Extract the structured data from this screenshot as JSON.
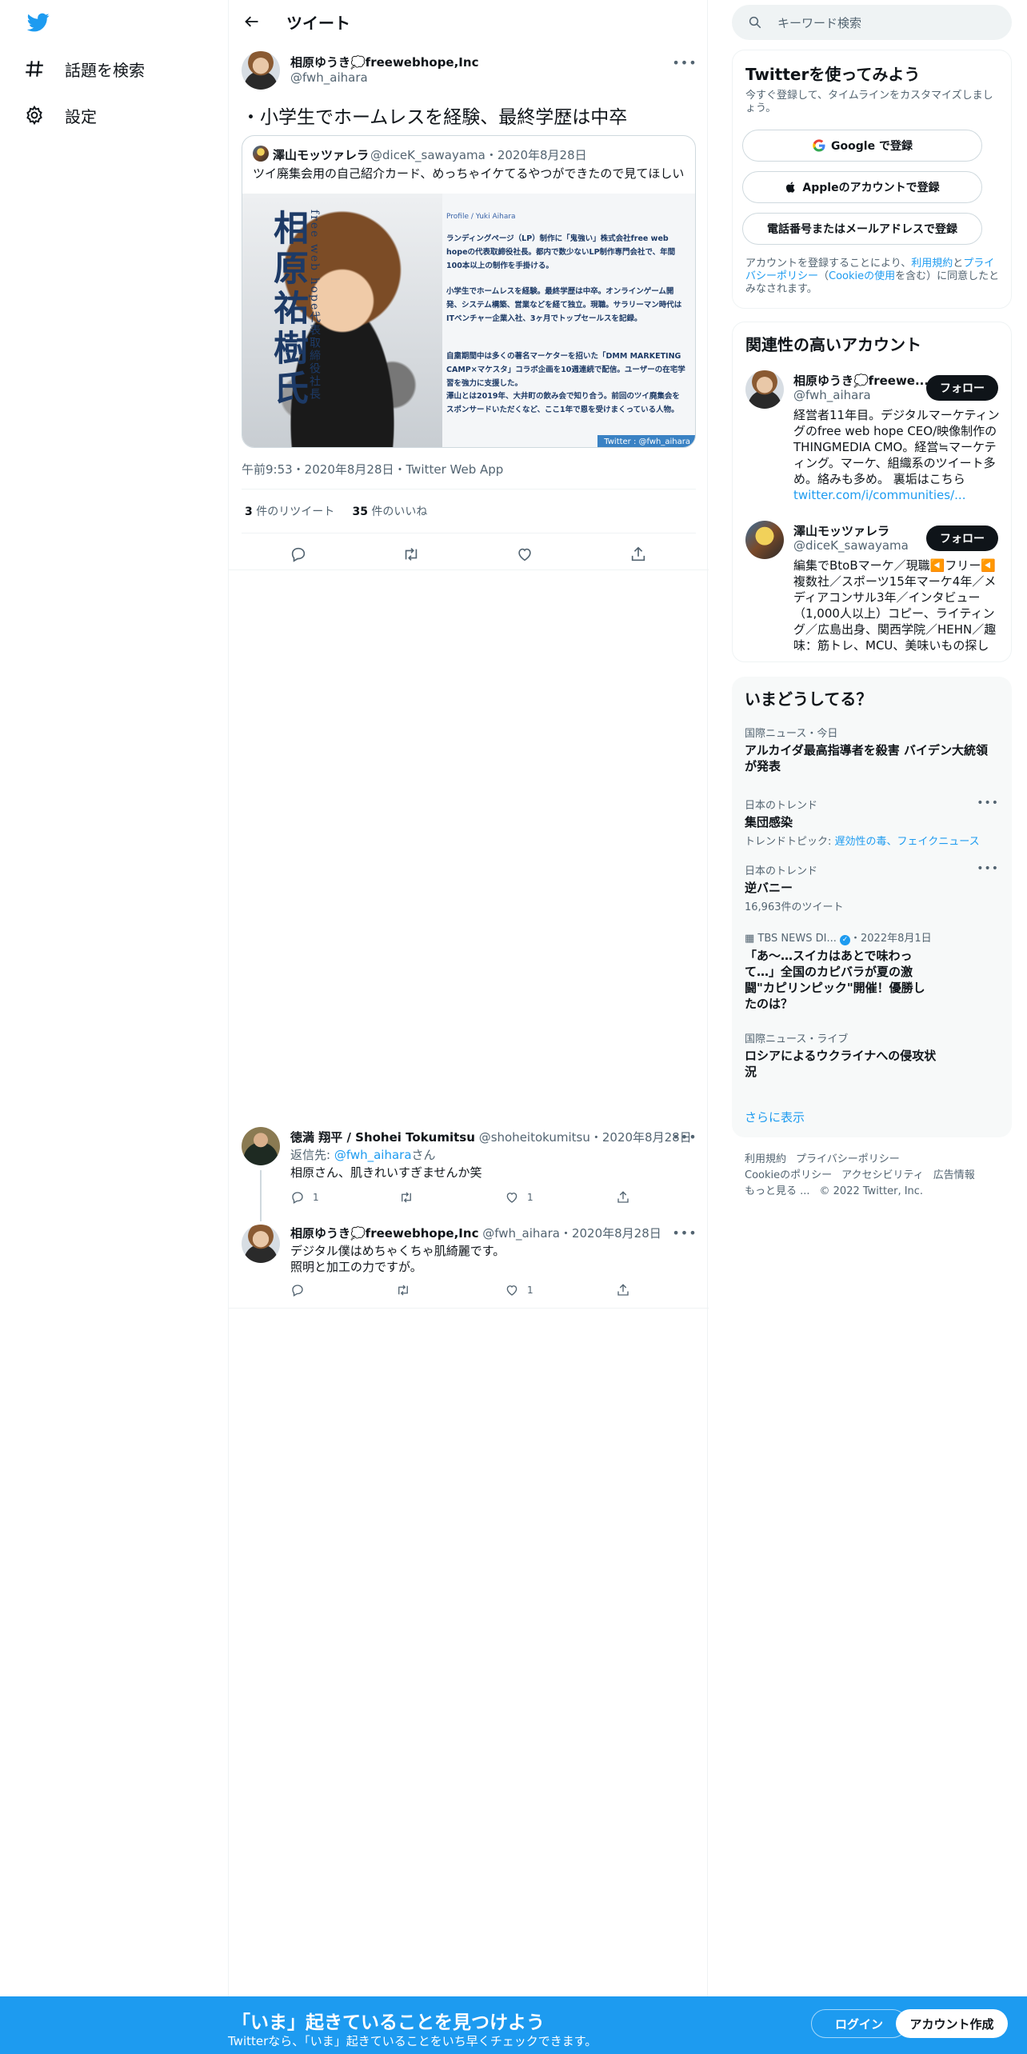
{
  "nav": {
    "items": [
      {
        "label": "話題を検索",
        "icon": "hashtag-icon"
      },
      {
        "label": "設定",
        "icon": "gear-icon"
      }
    ]
  },
  "header": {
    "title": "ツイート"
  },
  "main_tweet": {
    "name": "相原ゆうき💭freewebhope,Inc",
    "handle": "@fwh_aihara",
    "text": "・小学生でホームレスを経験、最終学歴は中卒",
    "timestamp": "午前9:53・2020年8月28日・Twitter Web App",
    "retweets": "3",
    "retweets_label": "件のリツイート",
    "likes": "35",
    "likes_label": "件のいいね"
  },
  "quoted_tweet": {
    "name": "澤山モッツァレラ",
    "handle": "@diceK_sawayama・2020年8月28日",
    "text": "ツイ廃集会用の自己紹介カード、めっちゃイケてるやつができたので見てほしい",
    "image": {
      "vertical_title": "相原祐樹氏",
      "vertical_sub": "free web hope代表取締役社長",
      "profile_label": "Profile / Yuki Aihara",
      "paragraphs": [
        "ランディングページ（LP）制作に「鬼強い」株式会社free web hopeの代表取締役社長。都内で数少ないLP制作専門会社で、年間100本以上の制作を手掛ける。",
        "小学生でホームレスを経験。最終学歴は中卒。オンラインゲーム開発、システム構築、営業などを経て独立。現職。サラリーマン時代はITベンチャー企業入社、3ヶ月でトップセールスを記録。",
        "自粛期間中は多くの著名マーケターを招いた「DMM MARKETING CAMP×マケスタ」コラボ企画を10週連続で配信。ユーザーの在宅学習を強力に支援した。",
        "澤山とは2019年、大井町の飲み会で知り合う。前回のツイ廃集会をスポンサードいただくなど、ここ1年で恩を受けまくっている人物。"
      ],
      "tag": "Twitter : @fwh_aihara"
    }
  },
  "replies": [
    {
      "name": "徳満 翔平 / Shohei Tokumitsu",
      "handle": "@shoheitokumitsu・2020年8月28日",
      "reply_prefix": "返信先: ",
      "reply_to": "@fwh_aihara",
      "reply_suffix": "さん",
      "text": "相原さん、肌きれいすぎませんか笑",
      "replies": "1",
      "retweets": "",
      "likes": "1"
    },
    {
      "name": "相原ゆうき💭freewebhope,Inc",
      "handle": "@fwh_aihara・2020年8月28日",
      "text_line1": "デジタル僕はめちゃくちゃ肌綺麗です。",
      "text_line2": "照明と加工の力ですが。",
      "replies": "",
      "retweets": "",
      "likes": "1"
    }
  ],
  "search": {
    "placeholder": "キーワード検索"
  },
  "signup_panel": {
    "title": "Twitterを使ってみよう",
    "subtitle": "今すぐ登録して、タイムラインをカスタマイズしましょう。",
    "google_label": "Google で登録",
    "apple_label": "Appleのアカウントで登録",
    "phone_label": "電話番号またはメールアドレスで登録",
    "terms_pre": "アカウントを登録することにより、",
    "terms_link1": "利用規約",
    "terms_mid": "と",
    "terms_link2": "プライバシーポリシー",
    "terms_open": "（",
    "terms_link3": "Cookieの使用",
    "terms_post": "を含む）に同意したとみなされます。"
  },
  "related_panel": {
    "title": "関連性の高いアカウント",
    "accounts": [
      {
        "name": "相原ゆうき💭freewe...",
        "handle": "@fwh_aihara",
        "follow_label": "フォロー",
        "bio": "経営者11年目。デジタルマーケティングのfree web hope CEO/映像制作のTHINGMEDIA CMO。経営≒マーケティング。マーケ、組織系のツイート多め。絡みも多め。 裏垢はこちら",
        "bio_link": "twitter.com/i/communities/..."
      },
      {
        "name": "澤山モッツァレラ",
        "handle": "@diceK_sawayama",
        "follow_label": "フォロー",
        "bio": "編集でBtoBマーケ／現職◀️フリー◀️複数社／スポーツ15年マーケ4年／メディアコンサル3年／インタビュー（1,000人以上）コピー、ライティング／広島出身、関西学院／HEHN／趣味：筋トレ、MCU、美味いもの探し"
      }
    ]
  },
  "trends_panel": {
    "title": "いまどうしてる？",
    "trends": [
      {
        "meta": "国際ニュース・今日",
        "title": "アルカイダ最高指導者を殺害 バイデン大統領が発表"
      },
      {
        "meta": "日本のトレンド",
        "title": "集団感染",
        "topic_prefix": "トレンドトピック: ",
        "topic_links": "遅効性の毒、フェイクニュース"
      },
      {
        "meta": "日本のトレンド",
        "title": "逆バニー",
        "count": "16,963件のツイート"
      },
      {
        "meta_source": "TBS NEWS DI...",
        "meta_date": "・2022年8月1日",
        "title": "「あ〜…スイカはあとで味わって…」全国のカピバラが夏の激闘\"カピリンピック\"開催！優勝したのは？"
      },
      {
        "meta": "国際ニュース・ライブ",
        "title": "ロシアによるウクライナへの侵攻状況"
      }
    ],
    "show_more": "さらに表示"
  },
  "footer": {
    "links": [
      "利用規約",
      "プライバシーポリシー",
      "Cookieのポリシー",
      "アクセシビリティ",
      "広告情報",
      "もっと見る ...",
      "© 2022 Twitter, Inc."
    ]
  },
  "bottom_bar": {
    "title": "「いま」起きていることを見つけよう",
    "subtitle": "Twitterなら、「いま」起きていることをいち早くチェックできます。",
    "login_label": "ログイン",
    "signup_label": "アカウント作成"
  },
  "colors": {
    "accent": "#1d9bf0",
    "text": "#0f1419",
    "muted": "#536471",
    "border": "#eff3f4"
  }
}
